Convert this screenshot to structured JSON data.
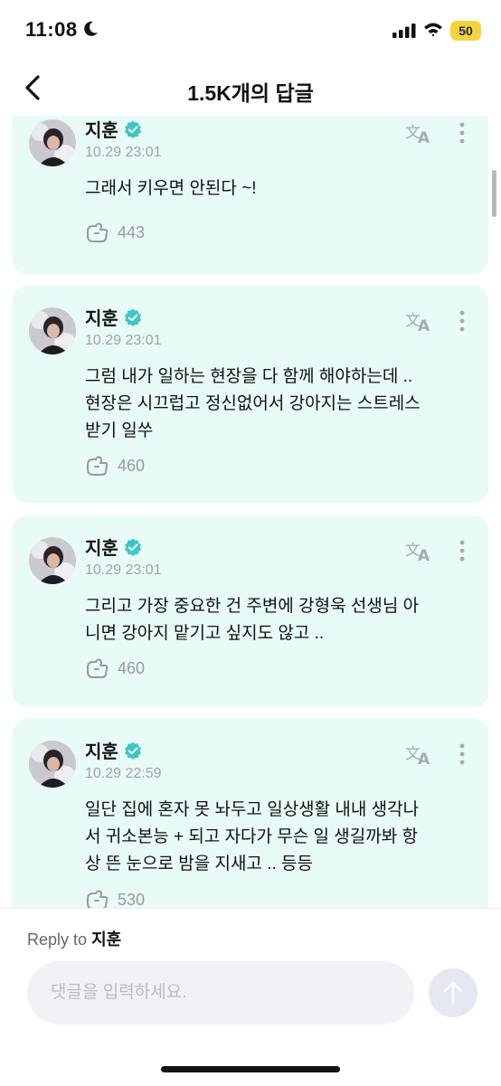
{
  "status": {
    "time": "11:08",
    "battery": "50"
  },
  "nav": {
    "title": "1.5K개의 답글"
  },
  "comments": [
    {
      "author": "지훈",
      "date": "10.29 23:01",
      "lines": [
        "그래서 키우면 안된다 ~!"
      ],
      "likes": "443"
    },
    {
      "author": "지훈",
      "date": "10.29 23:01",
      "lines": [
        "그럼 내가 일하는 현장을 다 함께 해야하는데 ..",
        "현장은 시끄럽고 정신없어서 강아지는 스트레스",
        "받기 일쑤"
      ],
      "likes": "460"
    },
    {
      "author": "지훈",
      "date": "10.29 23:01",
      "lines": [
        "그리고 가장 중요한 건 주변에 강형욱 선생님 아",
        "니면 강아지 맡기고 싶지도 않고 .."
      ],
      "likes": "460"
    },
    {
      "author": "지훈",
      "date": "10.29 22:59",
      "lines": [
        "일단 집에 혼자 못 놔두고 일상생활 내내 생각나",
        "서 귀소본능 + 되고 자다가 무슨 일 생길까봐 항",
        "상 뜬 눈으로 밤을 지새고 .. 등등"
      ],
      "likes": "530"
    }
  ],
  "reply": {
    "label": "Reply to",
    "name": "지훈",
    "placeholder": "댓글을 입력하세요."
  }
}
